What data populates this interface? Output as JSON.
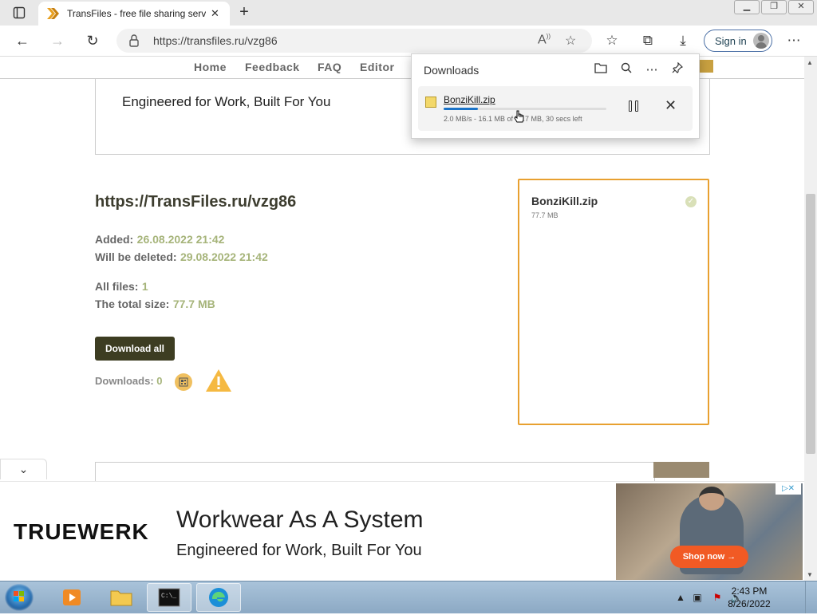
{
  "browser": {
    "tab_title": "TransFiles - free file sharing servi",
    "url": "https://transfiles.ru/vzg86",
    "signin_label": "Sign in"
  },
  "site_nav": [
    "Home",
    "Feedback",
    "FAQ",
    "Editor"
  ],
  "top_banner": {
    "tagline": "Engineered for Work, Built For You"
  },
  "share": {
    "url": "https://TransFiles.ru/vzg86",
    "added_label": "Added:",
    "added_value": "26.08.2022 21:42",
    "deleted_label": "Will be deleted:",
    "deleted_value": "29.08.2022 21:42",
    "files_label": "All files:",
    "files_value": "1",
    "size_label": "The total size:",
    "size_value": "77.7 MB",
    "download_all_label": "Download all",
    "downloads_label": "Downloads:",
    "downloads_value": "0"
  },
  "file_card": {
    "name": "BonziKill.zip",
    "size": "77.7 MB"
  },
  "downloads_panel": {
    "title": "Downloads",
    "item": {
      "name": "BonziKill.zip",
      "status": "2.0 MB/s - 16.1 MB of 77.7 MB, 30 secs left",
      "progress": 0.21
    }
  },
  "ad": {
    "brand": "TRUEWERK",
    "headline": "Workwear As A System",
    "tagline": "Engineered for Work, Built For You",
    "cta": "Shop now →"
  },
  "taskbar": {
    "time": "2:43 PM",
    "date": "8/26/2022"
  }
}
